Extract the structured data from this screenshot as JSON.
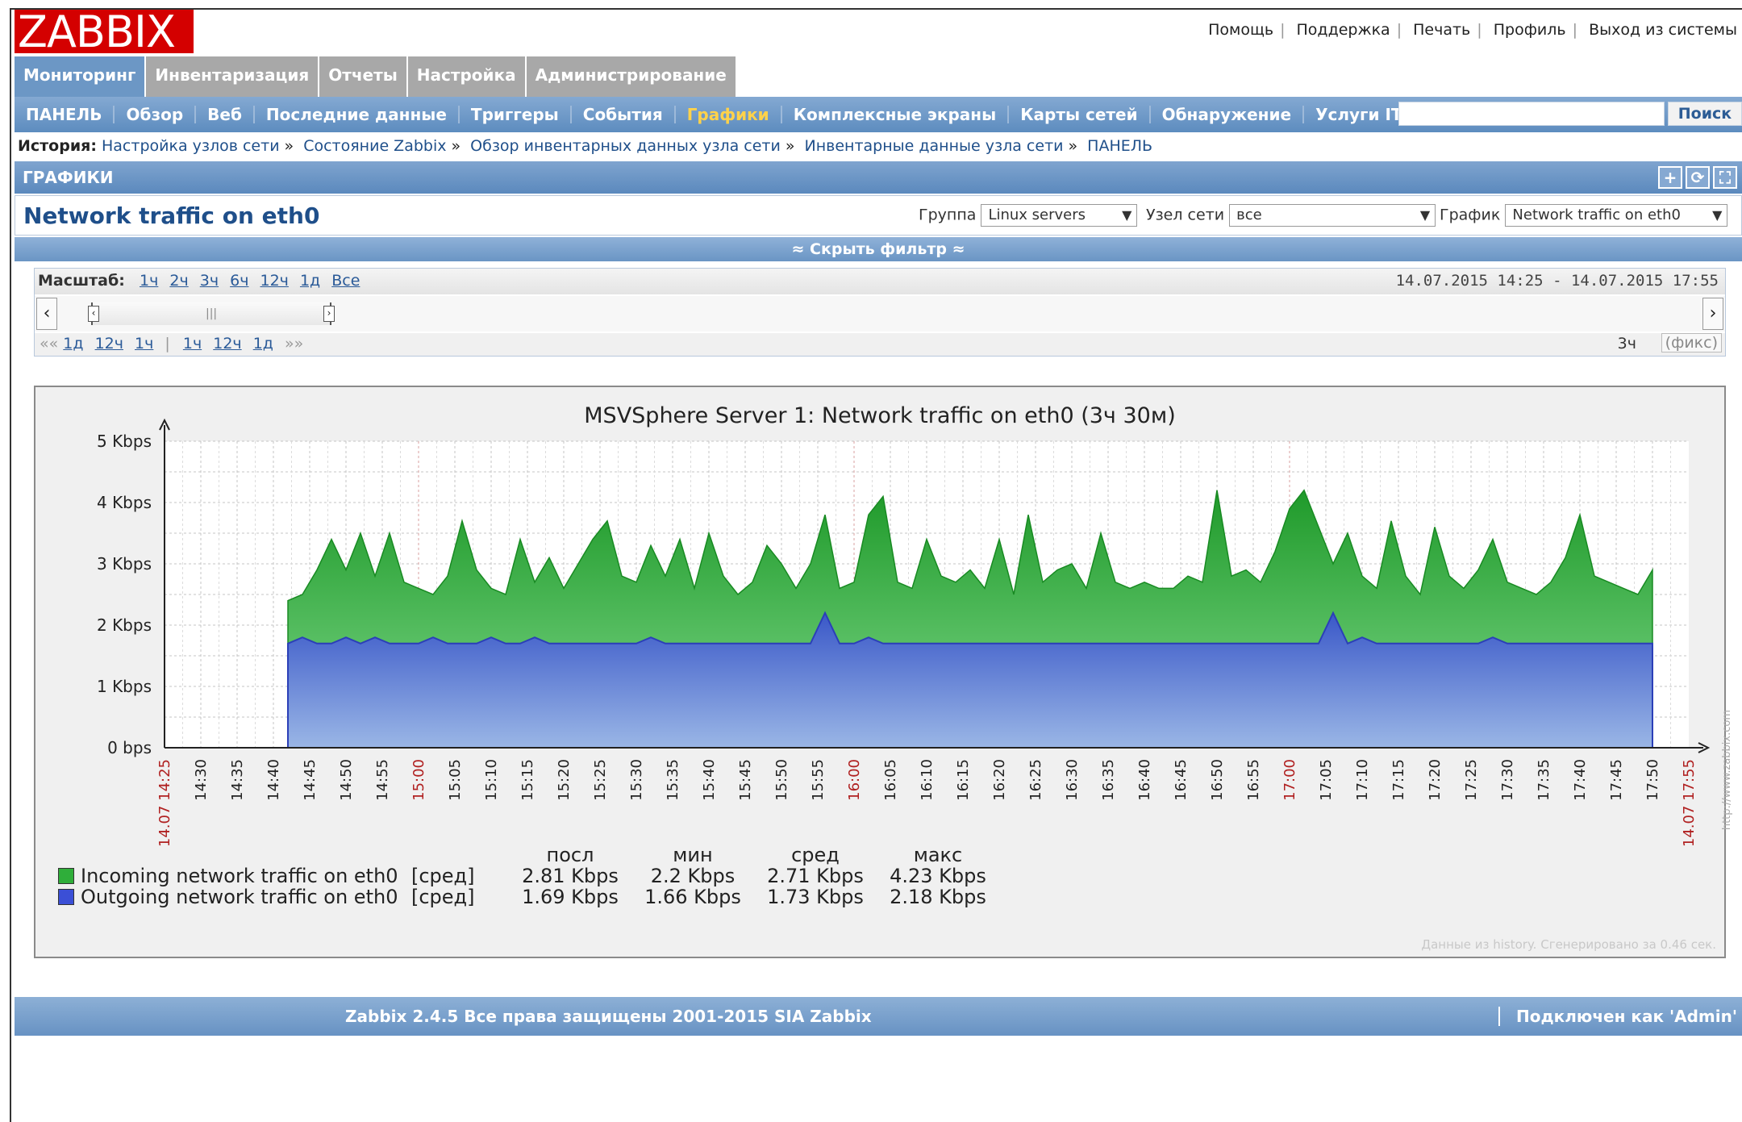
{
  "header": {
    "logo": "ZABBIX",
    "links": [
      "Помощь",
      "Поддержка",
      "Печать",
      "Профиль",
      "Выход из системы"
    ]
  },
  "main_menu": [
    {
      "label": "Мониторинг",
      "active": true
    },
    {
      "label": "Инвентаризация",
      "active": false
    },
    {
      "label": "Отчеты",
      "active": false
    },
    {
      "label": "Настройка",
      "active": false
    },
    {
      "label": "Администрирование",
      "active": false
    }
  ],
  "sub_menu": [
    {
      "label": "ПАНЕЛЬ",
      "active": false
    },
    {
      "label": "Обзор",
      "active": false
    },
    {
      "label": "Веб",
      "active": false
    },
    {
      "label": "Последние данные",
      "active": false
    },
    {
      "label": "Триггеры",
      "active": false
    },
    {
      "label": "События",
      "active": false
    },
    {
      "label": "Графики",
      "active": true
    },
    {
      "label": "Комплексные экраны",
      "active": false
    },
    {
      "label": "Карты сетей",
      "active": false
    },
    {
      "label": "Обнаружение",
      "active": false
    },
    {
      "label": "Услуги IT",
      "active": false
    }
  ],
  "search": {
    "value": "",
    "button": "Поиск"
  },
  "history": {
    "label": "История:",
    "items": [
      "Настройка узлов сети",
      "Состояние Zabbix",
      "Обзор инвентарных данных узла сети",
      "Инвентарные данные узла сети",
      "ПАНЕЛЬ"
    ]
  },
  "section": {
    "title": "ГРАФИКИ"
  },
  "filter": {
    "page_title": "Network traffic on eth0",
    "group_label": "Группа",
    "group_value": "Linux servers",
    "host_label": "Узел сети",
    "host_value": "все",
    "graph_label": "График",
    "graph_value": "Network traffic on eth0",
    "hide_filter": "Скрыть фильтр"
  },
  "timeline": {
    "zoom_label": "Масштаб:",
    "zoom_options": [
      "1ч",
      "2ч",
      "3ч",
      "6ч",
      "12ч",
      "1д",
      "Все"
    ],
    "date_from": "14.07.2015 14:25",
    "date_to": "14.07.2015 17:55",
    "back_prefix": "««",
    "back_links": [
      "1д",
      "12ч",
      "1ч"
    ],
    "fwd_links": [
      "1ч",
      "12ч",
      "1д"
    ],
    "fwd_suffix": "»»",
    "period": "3ч",
    "fixed_label": "(фикс)"
  },
  "graph": {
    "title": "MSVSphere Server 1: Network traffic on eth0 (3ч 30м)",
    "note": "Данные из history. Сгенерировано за 0.46 сек.",
    "watermark": "http://www.zabbix.com",
    "legend_headers": [
      "посл",
      "мин",
      "сред",
      "макс"
    ]
  },
  "chart_data": {
    "type": "area",
    "title": "MSVSphere Server 1: Network traffic on eth0 (3ч 30м)",
    "y_unit": "bps",
    "yticks": [
      "0 bps",
      "1 Kbps",
      "2 Kbps",
      "3 Kbps",
      "4 Kbps",
      "5 Kbps"
    ],
    "ylim": [
      0,
      5
    ],
    "x_start_label": "14.07 14:25",
    "x_end_label": "14.07 17:55",
    "x_ticks": [
      "14:30",
      "14:35",
      "14:40",
      "14:45",
      "14:50",
      "14:55",
      "15:00",
      "15:05",
      "15:10",
      "15:15",
      "15:20",
      "15:25",
      "15:30",
      "15:35",
      "15:40",
      "15:45",
      "15:50",
      "15:55",
      "16:00",
      "16:05",
      "16:10",
      "16:15",
      "16:20",
      "16:25",
      "16:30",
      "16:35",
      "16:40",
      "16:45",
      "16:50",
      "16:55",
      "17:00",
      "17:05",
      "17:10",
      "17:15",
      "17:20",
      "17:25",
      "17:30",
      "17:35",
      "17:40",
      "17:45",
      "17:50"
    ],
    "x_major_ticks": [
      "15:00",
      "16:00",
      "17:00"
    ],
    "data_start": "14:42",
    "x_step_minutes": 2,
    "series": [
      {
        "name": "Incoming network traffic on eth0",
        "color": "#2fae3a",
        "function": "[сред]",
        "last": "2.81 Kbps",
        "min": "2.2 Kbps",
        "avg": "2.71 Kbps",
        "max": "4.23 Kbps",
        "values": [
          2.4,
          2.5,
          2.9,
          3.4,
          2.9,
          3.5,
          2.8,
          3.5,
          2.7,
          2.6,
          2.5,
          2.8,
          3.7,
          2.9,
          2.6,
          2.5,
          3.4,
          2.7,
          3.1,
          2.6,
          3.0,
          3.4,
          3.7,
          2.8,
          2.7,
          3.3,
          2.8,
          3.4,
          2.6,
          3.5,
          2.8,
          2.5,
          2.7,
          3.3,
          3.0,
          2.6,
          3.0,
          3.8,
          2.6,
          2.7,
          3.8,
          4.1,
          2.7,
          2.6,
          3.4,
          2.8,
          2.7,
          2.9,
          2.6,
          3.4,
          2.5,
          3.8,
          2.7,
          2.9,
          3.0,
          2.6,
          3.5,
          2.7,
          2.6,
          2.7,
          2.6,
          2.6,
          2.8,
          2.7,
          4.2,
          2.8,
          2.9,
          2.7,
          3.2,
          3.9,
          4.2,
          3.6,
          3.0,
          3.5,
          2.8,
          2.6,
          3.7,
          2.8,
          2.5,
          3.6,
          2.8,
          2.6,
          2.9,
          3.4,
          2.7,
          2.6,
          2.5,
          2.7,
          3.1,
          3.8,
          2.8,
          2.7,
          2.6,
          2.5,
          2.9,
          2.9,
          2.8,
          2.8,
          2.9,
          2.8,
          2.8,
          2.8
        ]
      },
      {
        "name": "Outgoing network traffic on eth0",
        "color": "#3b4fd6",
        "function": "[сред]",
        "last": "1.69 Kbps",
        "min": "1.66 Kbps",
        "avg": "1.73 Kbps",
        "max": "2.18 Kbps",
        "values": [
          1.7,
          1.8,
          1.7,
          1.7,
          1.8,
          1.7,
          1.8,
          1.7,
          1.7,
          1.7,
          1.8,
          1.7,
          1.7,
          1.7,
          1.8,
          1.7,
          1.7,
          1.8,
          1.7,
          1.7,
          1.7,
          1.7,
          1.7,
          1.7,
          1.7,
          1.8,
          1.7,
          1.7,
          1.7,
          1.7,
          1.7,
          1.7,
          1.7,
          1.7,
          1.7,
          1.7,
          1.7,
          2.2,
          1.7,
          1.7,
          1.8,
          1.7,
          1.7,
          1.7,
          1.7,
          1.7,
          1.7,
          1.7,
          1.7,
          1.7,
          1.7,
          1.7,
          1.7,
          1.7,
          1.7,
          1.7,
          1.7,
          1.7,
          1.7,
          1.7,
          1.7,
          1.7,
          1.7,
          1.7,
          1.7,
          1.7,
          1.7,
          1.7,
          1.7,
          1.7,
          1.7,
          1.7,
          2.2,
          1.7,
          1.8,
          1.7,
          1.7,
          1.7,
          1.7,
          1.7,
          1.7,
          1.7,
          1.7,
          1.8,
          1.7,
          1.7,
          1.7,
          1.7,
          1.7,
          1.7,
          1.7,
          1.7,
          1.7,
          1.7,
          1.7,
          1.7,
          1.7,
          1.7,
          1.7,
          1.7,
          1.7,
          1.7,
          1.7
        ]
      }
    ]
  },
  "footer": {
    "copyright": "Zabbix 2.4.5 Все права защищены 2001-2015 SIA Zabbix",
    "logged_in": "Подключен как 'Admin'"
  }
}
